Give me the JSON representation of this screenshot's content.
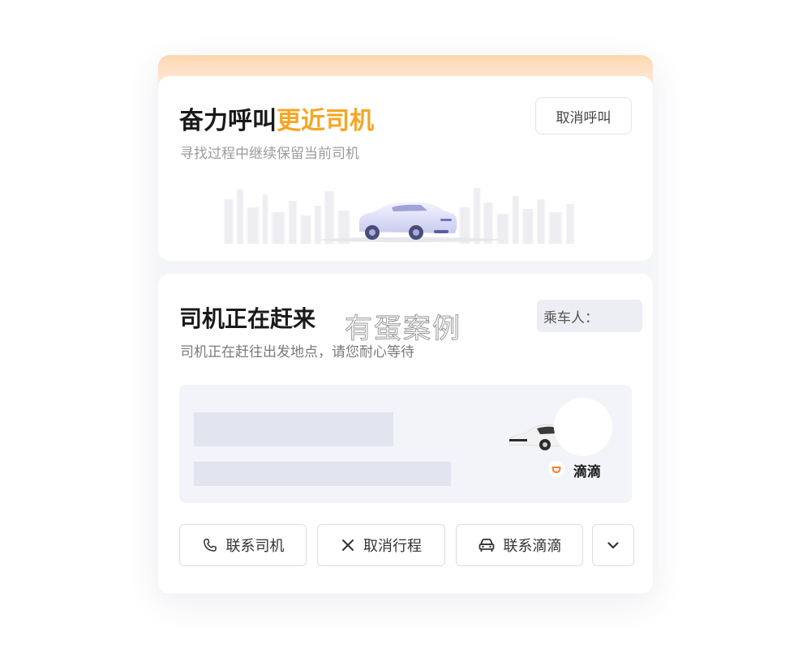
{
  "searching_card": {
    "title_main": "奋力呼叫",
    "title_highlight": "更近司机",
    "subtitle": "寻找过程中继续保留当前司机",
    "cancel_call_label": "取消呼叫"
  },
  "driver_card": {
    "title": "司机正在赶来",
    "subtitle": "司机正在赶往出发地点，请您耐心等待",
    "passenger_label": "乘车人：",
    "brand_name": "滴滴"
  },
  "watermark": "有蛋案例",
  "actions": {
    "contact_driver": "联系司机",
    "cancel_trip": "取消行程",
    "contact_didi": "联系滴滴"
  },
  "colors": {
    "accent": "#f5a623",
    "brand_orange": "#ff7d2e"
  },
  "icons": {
    "contact_driver": "phone-icon",
    "cancel_trip": "close-icon",
    "contact_didi": "car-icon",
    "more": "chevron-down-icon"
  }
}
